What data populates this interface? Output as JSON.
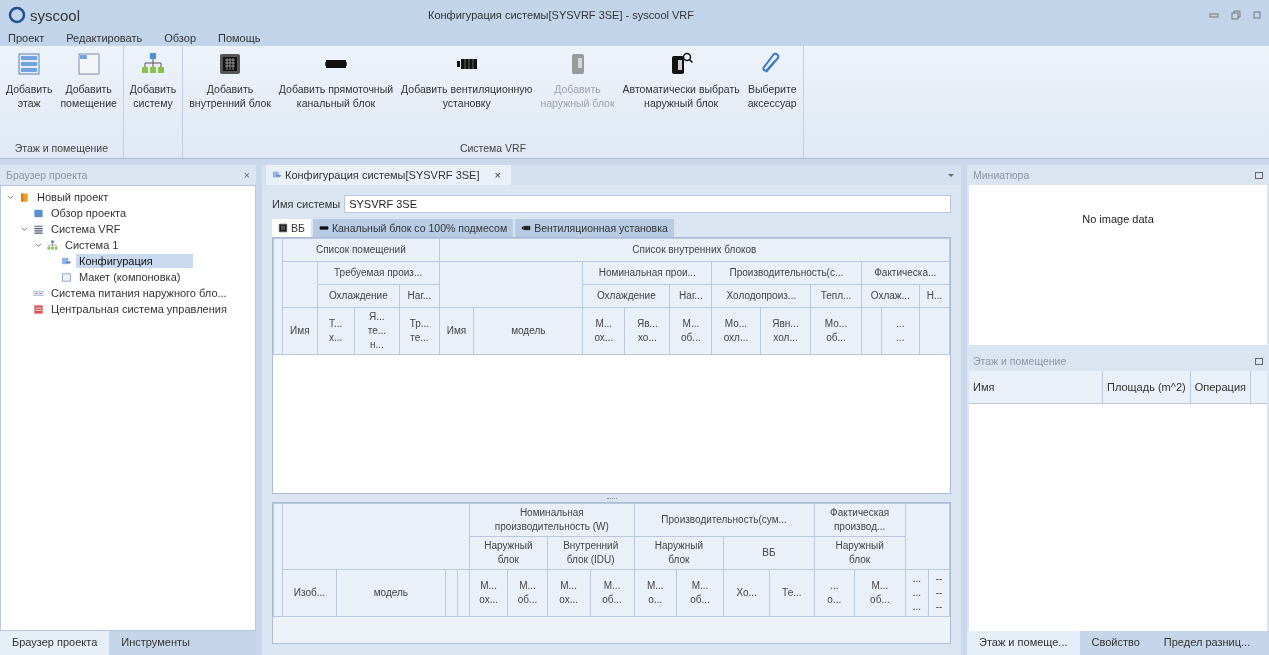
{
  "app": {
    "logo": "syscool",
    "title": "Конфигурация системы[SYSVRF 3SE] - syscool VRF"
  },
  "menu": [
    "Проект",
    "Редактировать",
    "Обзор",
    "Помощь"
  ],
  "ribbon": [
    {
      "label": "Этаж и помещение",
      "buttons": [
        {
          "label": "Добавить\nэтаж",
          "disabled": false
        },
        {
          "label": "Добавить\nпомещение",
          "disabled": false
        }
      ]
    },
    {
      "buttons": [
        {
          "label": "Добавить\nсистему",
          "disabled": false
        }
      ]
    },
    {
      "label": "Система VRF",
      "buttons": [
        {
          "label": "Добавить\nвнутренний блок",
          "disabled": false
        },
        {
          "label": "Добавить прямоточный\nканальный блок",
          "disabled": false
        },
        {
          "label": "Добавить вентиляционную\nустановку",
          "disabled": false
        },
        {
          "label": "Добавить\nнаружный блок",
          "disabled": true
        },
        {
          "label": "Автоматически выбрать\nнаружный блок",
          "disabled": false
        },
        {
          "label": "Выберите\nаксессуар",
          "disabled": false
        }
      ]
    }
  ],
  "left_panel": {
    "title": "Браузер проекта",
    "close": "×",
    "tree": [
      {
        "label": "Новый проект",
        "expanded": true,
        "selected": false,
        "children": [
          {
            "label": "Обзор проекта",
            "selected": false
          },
          {
            "label": "Система VRF",
            "expanded": true,
            "selected": false,
            "children": [
              {
                "label": "Система 1",
                "expanded": true,
                "selected": false,
                "children": [
                  {
                    "label": "Конфигурация",
                    "selected": true
                  },
                  {
                    "label": "Макет (компоновка)",
                    "selected": false
                  }
                ]
              }
            ]
          },
          {
            "label": "Система питания наружного бло...",
            "selected": false
          },
          {
            "label": "Центральная система управления",
            "selected": false
          }
        ]
      }
    ],
    "tabs": [
      {
        "label": "Браузер проекта",
        "selected": true
      },
      {
        "label": "Инструменты",
        "selected": false
      }
    ]
  },
  "document": {
    "tab": "Конфигурация системы[SYSVRF 3SE]",
    "tab_close": "×",
    "system_name_label": "Имя системы",
    "system_name": "SYSVRF 3SE",
    "tabs": [
      {
        "label": "ВБ",
        "selected": true
      },
      {
        "label": "Канальный блок со 100% подмесом",
        "selected": false
      },
      {
        "label": "Вентиляционная установка",
        "selected": false
      }
    ],
    "upper_table": {
      "header_rows": [
        [
          {
            "rowspan": 4
          },
          {
            "text": "Список помещений",
            "colspan": 4
          },
          {
            "text": "Список внутренних блоков",
            "colspan": 11
          }
        ],
        [
          {
            "rowspan": 2
          },
          {
            "text": "Требуемая произ...",
            "colspan": 3
          },
          {
            "colspan": 2,
            "rowspan": 2
          },
          {
            "text": "Номинальная прои...",
            "colspan": 3
          },
          {
            "text": "Производительность(с...",
            "colspan": 3
          },
          {
            "text": "Фактическа...",
            "colspan": 3
          }
        ],
        [
          {
            "text": "Охлаждение",
            "colspan": 2
          },
          {
            "text": "Наг..."
          },
          {
            "text": "Охлаждение",
            "colspan": 2
          },
          {
            "text": "Наг..."
          },
          {
            "text": "Холодопроиз...",
            "colspan": 2
          },
          {
            "text": "Тепл..."
          },
          {
            "text": "Охлаж...",
            "colspan": 2
          },
          {
            "text": "Н..."
          }
        ],
        [
          {
            "text": "Имя"
          },
          {
            "text": "Т...\nх..."
          },
          {
            "text": "Я...\nте...\nн..."
          },
          {
            "text": "Тр...\nте..."
          },
          {
            "text": "Имя"
          },
          {
            "text": "модель"
          },
          {
            "text": "М...\nох..."
          },
          {
            "text": "Яв...\nхо..."
          },
          {
            "text": "М...\nоб..."
          },
          {
            "text": "Мо...\nохл..."
          },
          {
            "text": "Явн...\nхол..."
          },
          {
            "text": "Мо...\nоб..."
          },
          {},
          {
            "text": "...\n..."
          },
          {}
        ]
      ]
    },
    "lower_table": {
      "header_rows": [
        [
          {
            "rowspan": 3
          },
          {
            "colspan": 4,
            "rowspan": 2
          },
          {
            "text": "Номинальная\nпроизводительность (W)",
            "colspan": 4
          },
          {
            "text": "Производительность(сум...",
            "colspan": 4
          },
          {
            "text": "Фактическая\nпроизвод...",
            "colspan": 2
          },
          {
            "colspan": 2,
            "rowspan": 2
          }
        ],
        [
          {
            "text": "Наружный\nблок",
            "colspan": 2
          },
          {
            "text": "Внутренний\nблок (IDU)",
            "colspan": 2
          },
          {
            "text": "Наружный\nблок",
            "colspan": 2
          },
          {
            "text": "ВБ",
            "colspan": 2
          },
          {
            "text": "Наружный\nблок",
            "colspan": 2
          }
        ],
        [
          {
            "text": "Изоб..."
          },
          {
            "text": "модель"
          },
          {},
          {},
          {
            "text": "М...\nох..."
          },
          {
            "text": "М...\nоб..."
          },
          {
            "text": "М...\nох..."
          },
          {
            "text": "М...\nоб..."
          },
          {
            "text": "М...\nо..."
          },
          {
            "text": "М...\nоб..."
          },
          {
            "text": "Хо..."
          },
          {
            "text": "Те..."
          },
          {
            "text": "...\nо..."
          },
          {
            "text": "М...\nоб..."
          },
          {
            "text": "...\n...\n..."
          },
          {
            "text": "--\n--\n--"
          }
        ]
      ]
    }
  },
  "right_panel": {
    "thumbnail": {
      "title": "Миниатюра",
      "message": "No image data"
    },
    "floors": {
      "title": "Этаж и помещение",
      "columns": [
        "Имя",
        "Площадь (m^2)",
        "Операция"
      ]
    },
    "tabs": [
      {
        "label": "Этаж и помеще...",
        "selected": true
      },
      {
        "label": "Свойство",
        "selected": false
      },
      {
        "label": "Предел разниц...",
        "selected": false
      }
    ]
  }
}
